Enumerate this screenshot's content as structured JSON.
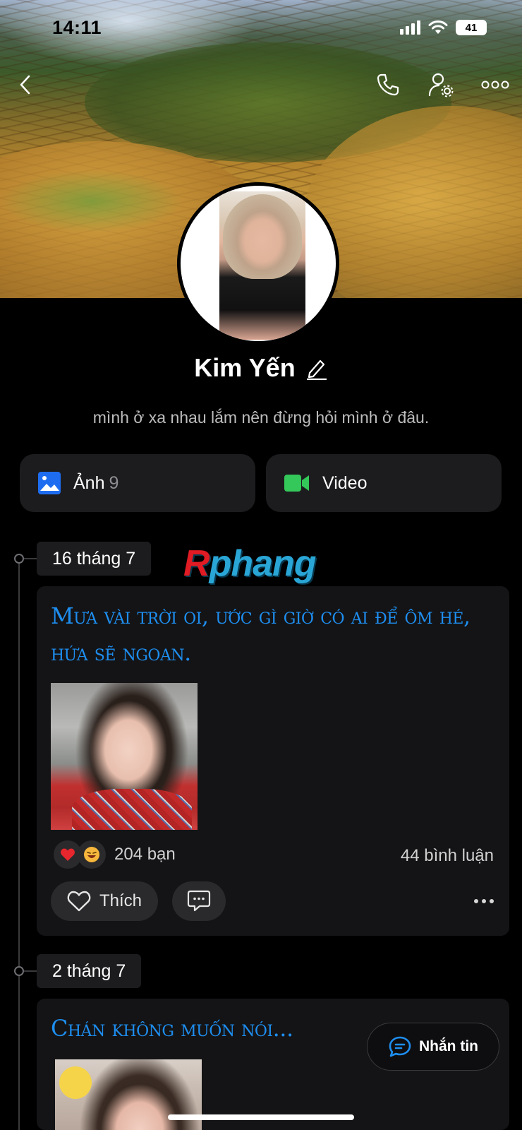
{
  "status_bar": {
    "time": "14:11",
    "battery": "41"
  },
  "profile": {
    "name": "Kim Yến",
    "bio": "mình ở xa nhau lắm nên đừng hỏi mình ở đâu."
  },
  "media": {
    "photos_label": "Ảnh",
    "photos_count": "9",
    "video_label": "Video"
  },
  "watermark": {
    "first": "R",
    "rest": "phang"
  },
  "posts": [
    {
      "date": "16 tháng 7",
      "text": "Mưa vài trời oi, ước gì giờ có ai để ôm hé, hứa sẽ ngoan.",
      "reactions": [
        "heart",
        "laugh"
      ],
      "reaction_count": "204 bạn",
      "comment_count": "44 bình luận",
      "like_label": "Thích"
    },
    {
      "date": "2 tháng 7",
      "text": "Chán không muốn nói..."
    }
  ],
  "floating": {
    "message_label": "Nhắn tin"
  },
  "colors": {
    "accent_blue": "#1e8ef0",
    "photo_icon": "#1e6df0",
    "video_icon": "#34c759",
    "card_bg": "#1c1c1e"
  }
}
